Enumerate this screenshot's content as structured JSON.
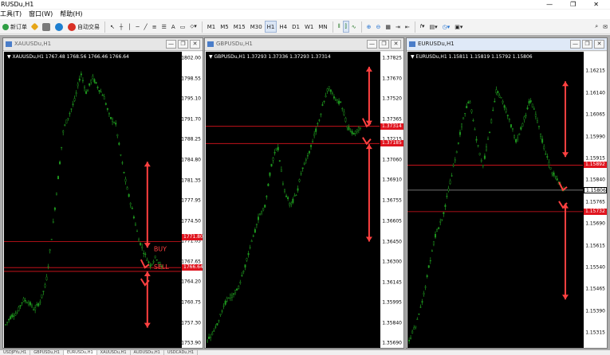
{
  "app": {
    "title": "RUSDu,H1",
    "win_minimize": "—",
    "win_restore": "❐",
    "win_close": "✕"
  },
  "menu": [
    "工具(T)",
    "窗口(W)",
    "帮助(H)"
  ],
  "toolbar": {
    "new_order": "新订单",
    "auto_trading": "自动交易",
    "timeframes": [
      "M1",
      "M5",
      "M15",
      "M30",
      "H1",
      "H4",
      "D1",
      "W1",
      "MN"
    ],
    "active_timeframe": "H1"
  },
  "charts": [
    {
      "window_title": "XAUUSDu,H1",
      "info": "▼ XAUUSDu,H1  1767.48 1768.56 1766.46 1766.64",
      "ticks": [
        "1802.00",
        "1798.55",
        "1795.10",
        "1791.70",
        "1788.25",
        "1784.80",
        "1781.35",
        "1777.95",
        "1774.50",
        "1771.05",
        "1767.65",
        "1764.20",
        "1760.75",
        "1757.30",
        "1753.90"
      ],
      "price_tags": [
        {
          "label": "1771.80",
          "color": "#e0141e"
        },
        {
          "label": "1766.64",
          "color": "#e0141e"
        }
      ],
      "annotations": [
        "BUY",
        "SELL"
      ],
      "range": [
        1753.9,
        1802.0
      ],
      "hlines": [
        1771.05,
        1766.64,
        1766.0
      ],
      "close": 1766.64,
      "path_points": [
        1757.0,
        1758.5,
        1759.0,
        1761.2,
        1760.8,
        1759.5,
        1761.0,
        1764.0,
        1772.0,
        1781.0,
        1790.0,
        1792.5,
        1795.0,
        1799.5,
        1796.0,
        1798.8,
        1797.0,
        1795.5,
        1792.0,
        1791.0,
        1785.0,
        1780.0,
        1776.0,
        1771.5,
        1769.0,
        1767.0,
        1768.5,
        1766.64
      ],
      "arrows": [
        {
          "x": 0.81,
          "y1": 1784.5,
          "y2": 1770.0
        },
        {
          "x": 0.81,
          "y1": 1766.0,
          "y2": 1756.5
        }
      ]
    },
    {
      "window_title": "GBPUSDu,H1",
      "info": "▼ GBPUSDu,H1  1.37293 1.37336 1.37293 1.37314",
      "ticks": [
        "1.37825",
        "1.37670",
        "1.37520",
        "1.37365",
        "1.37215",
        "1.37060",
        "1.36910",
        "1.36755",
        "1.36605",
        "1.36450",
        "1.36300",
        "1.36145",
        "1.35995",
        "1.35840",
        "1.35690"
      ],
      "price_tags": [
        {
          "label": "1.37314",
          "color": "#e0141e"
        },
        {
          "label": "1.37185",
          "color": "#e0141e"
        }
      ],
      "annotations": [],
      "range": [
        1.3569,
        1.37825
      ],
      "hlines": [
        1.37314,
        1.37185
      ],
      "close": 1.37314,
      "path_points": [
        1.3571,
        1.3578,
        1.3589,
        1.3601,
        1.3605,
        1.3611,
        1.3628,
        1.3645,
        1.3662,
        1.3671,
        1.3702,
        1.3718,
        1.3685,
        1.3672,
        1.3681,
        1.3701,
        1.3712,
        1.3728,
        1.3745,
        1.3762,
        1.3752,
        1.3748,
        1.3731,
        1.3725,
        1.3731
      ],
      "arrows": [
        {
          "x": 0.94,
          "y1": 1.3776,
          "y2": 1.3732
        },
        {
          "x": 0.94,
          "y1": 1.3718,
          "y2": 1.3645
        }
      ]
    },
    {
      "window_title": "EURUSDu,H1",
      "info": "▼ EURUSDu,H1  1.15811 1.15819 1.15792 1.15806",
      "ticks": [
        "1.16215",
        "1.16140",
        "1.16065",
        "1.15990",
        "1.15915",
        "1.15840",
        "1.15765",
        "1.15690",
        "1.15615",
        "1.15540",
        "1.15465",
        "1.15390",
        "1.15315"
      ],
      "price_tags": [
        {
          "label": "1.15892",
          "color": "#e0141e"
        },
        {
          "label": "1.15806",
          "color": "#ffffff"
        },
        {
          "label": "1.15732",
          "color": "#e0141e"
        }
      ],
      "annotations": [],
      "range": [
        1.1528,
        1.1626
      ],
      "hlines": [
        1.15892,
        1.15806,
        1.15732
      ],
      "close": 1.15806,
      "path_points": [
        1.1529,
        1.1534,
        1.1542,
        1.1555,
        1.1566,
        1.1571,
        1.1582,
        1.1593,
        1.1605,
        1.1612,
        1.1598,
        1.1589,
        1.1601,
        1.1615,
        1.1611,
        1.1604,
        1.1597,
        1.1604,
        1.1612,
        1.1605,
        1.1596,
        1.1588,
        1.1584,
        1.1581
      ],
      "arrows": [
        {
          "x": 0.9,
          "y1": 1.1618,
          "y2": 1.1592
        },
        {
          "x": 0.9,
          "y1": 1.1576,
          "y2": 1.1543
        }
      ]
    }
  ],
  "tabs": [
    "USDJPYu,H1",
    "GBPUSDu,H1",
    "EURUSDu,H1",
    "XAUUSDu,H1",
    "AUDUSDu,H1",
    "USDCADu,H1"
  ],
  "active_tab": "EURUSDu,H1"
}
